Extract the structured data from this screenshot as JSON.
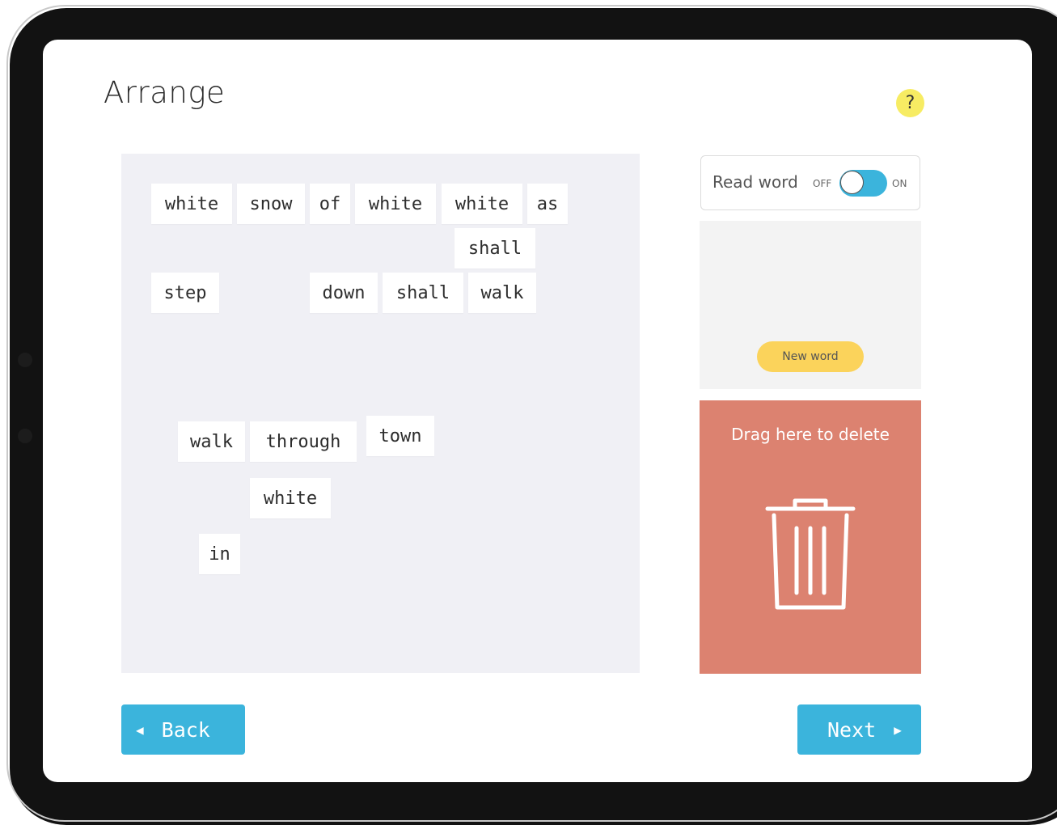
{
  "page": {
    "title": "Arrange",
    "help_label": "?"
  },
  "board": {
    "tiles": [
      {
        "text": "white"
      },
      {
        "text": "snow"
      },
      {
        "text": "of"
      },
      {
        "text": "white"
      },
      {
        "text": "white"
      },
      {
        "text": "as"
      },
      {
        "text": "shall"
      },
      {
        "text": "step"
      },
      {
        "text": "down"
      },
      {
        "text": "shall"
      },
      {
        "text": "walk"
      },
      {
        "text": "walk"
      },
      {
        "text": "through"
      },
      {
        "text": "town"
      },
      {
        "text": "white"
      },
      {
        "text": "in"
      }
    ]
  },
  "side_panel": {
    "read_word_label": "Read word",
    "toggle_off_label": "OFF",
    "toggle_on_label": "ON",
    "toggle_state": "ON",
    "new_word_label": "New word",
    "delete_label": "Drag here to delete"
  },
  "nav": {
    "back_label": "Back",
    "next_label": "Next",
    "back_arrow": "◀",
    "next_arrow": "▶"
  },
  "colors": {
    "accent": "#3bb4dc",
    "help_yellow": "#f7ec63",
    "new_word_yellow": "#fbd35b",
    "delete_red": "#dc8270",
    "board_bg": "#f0f0f5"
  },
  "icons": {
    "help": "question-mark-icon",
    "delete": "trash-icon",
    "back": "triangle-left-icon",
    "next": "triangle-right-icon"
  }
}
